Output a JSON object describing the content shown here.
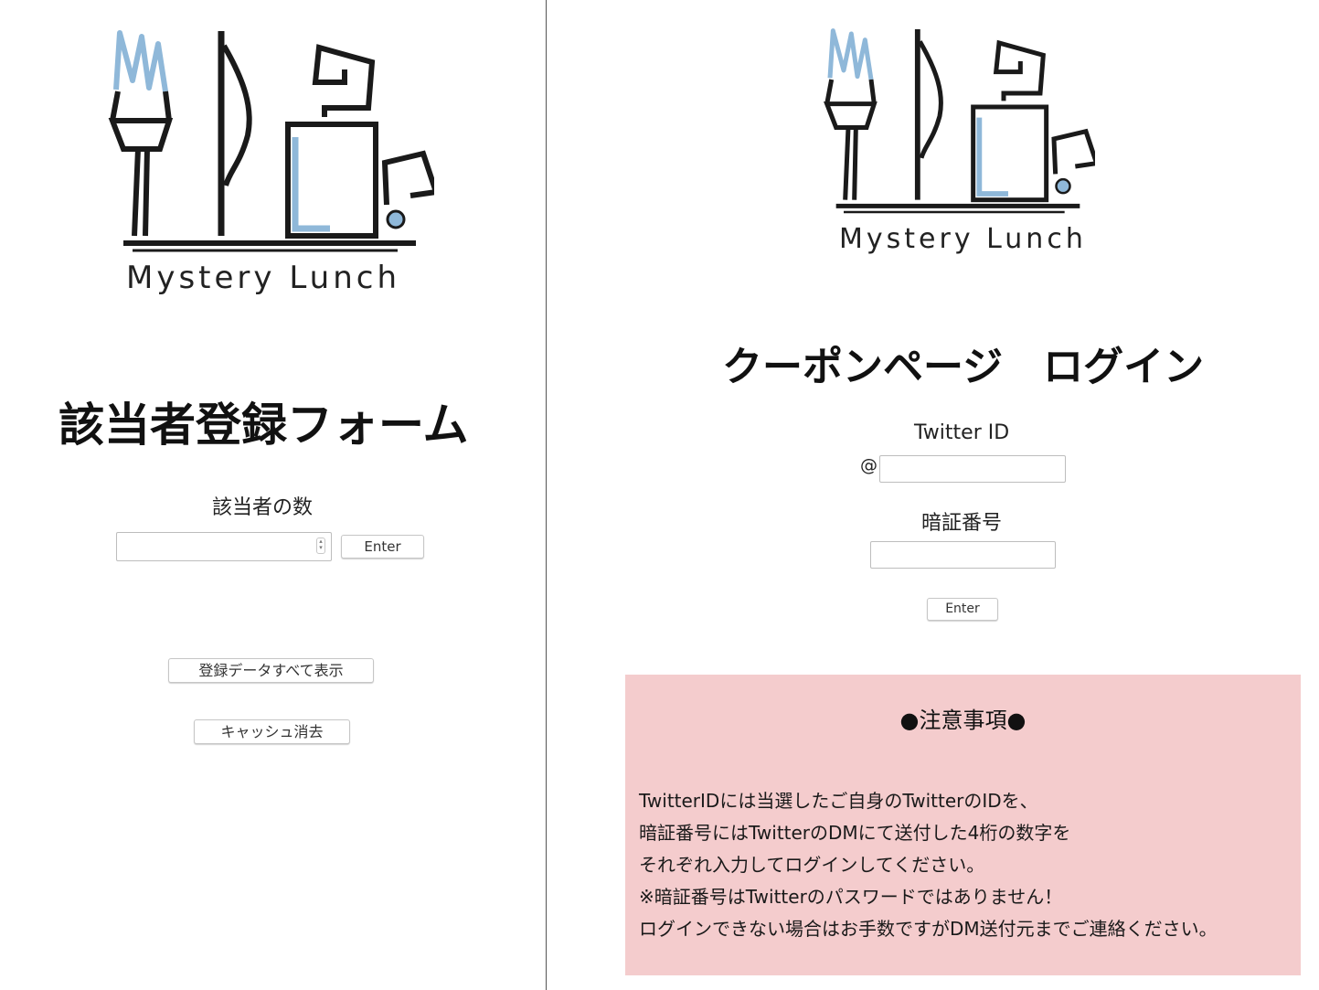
{
  "left_panel": {
    "brand": "Mystery Lunch",
    "heading": "該当者登録フォーム",
    "count_label": "該当者の数",
    "enter_label": "Enter",
    "show_all_label": "登録データすべて表示",
    "clear_cache_label": "キャッシュ消去"
  },
  "right_panel": {
    "brand": "Mystery Lunch",
    "heading": "クーポンページ　ログイン",
    "twitter_label": "Twitter ID",
    "at_sign": "@",
    "pin_label": "暗証番号",
    "enter_label": "Enter"
  },
  "notice": {
    "title": "●注意事項●",
    "lines": [
      "TwitterIDには当選したご自身のTwitterのIDを、",
      "暗証番号にはTwitterのDMにて送付した4桁の数字を",
      "それぞれ入力してログインしてください。",
      "※暗証番号はTwitterのパスワードではありません！",
      "ログインできない場合はお手数ですがDM送付元までご連絡ください。"
    ]
  },
  "colors": {
    "notice_bg": "#f4cccd",
    "logo_blue": "#8fb8d9",
    "logo_ink": "#1a1a1a"
  }
}
